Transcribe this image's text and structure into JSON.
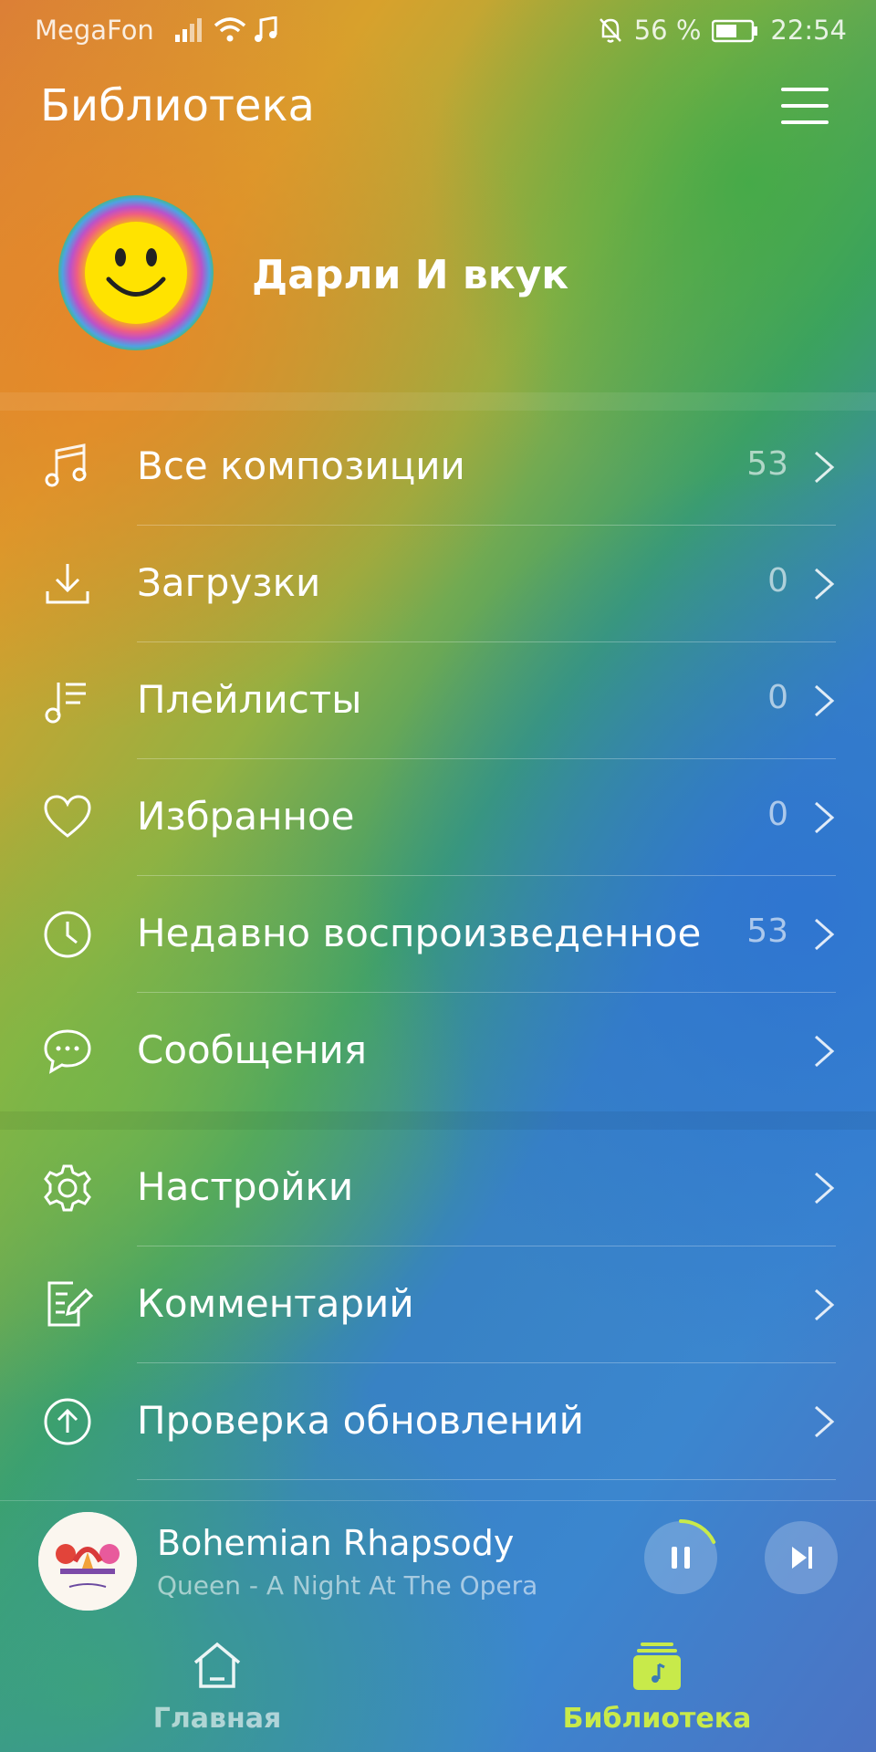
{
  "status_bar": {
    "carrier": "MegaFon",
    "battery": "56 %",
    "time": "22:54"
  },
  "header": {
    "title": "Библиотека",
    "menu_icon": "hamburger-menu-icon"
  },
  "profile": {
    "name": "Дарли И вкук",
    "avatar_icon": "smiley-face-avatar"
  },
  "library": {
    "items": [
      {
        "label": "Все композиции",
        "count": "53",
        "icon": "music-note-icon"
      },
      {
        "label": "Загрузки",
        "count": "0",
        "icon": "download-icon"
      },
      {
        "label": "Плейлисты",
        "count": "0",
        "icon": "playlist-icon"
      },
      {
        "label": "Избранное",
        "count": "0",
        "icon": "heart-icon"
      },
      {
        "label": "Недавно воспроизведенное",
        "count": "53",
        "icon": "clock-icon"
      },
      {
        "label": "Сообщения",
        "count": "",
        "icon": "chat-icon"
      }
    ]
  },
  "settings": {
    "items": [
      {
        "label": "Настройки",
        "icon": "gear-icon"
      },
      {
        "label": "Комментарий",
        "icon": "edit-note-icon"
      },
      {
        "label": "Проверка обновлений",
        "icon": "arrow-up-circle-icon"
      }
    ]
  },
  "player": {
    "title": "Bohemian Rhapsody",
    "subtitle": "Queen - A Night At The Opera",
    "progress": 0.18,
    "accent": "#c8ea4a"
  },
  "nav": {
    "home": "Главная",
    "library": "Библиотека",
    "active_color": "#c8ea4a"
  }
}
